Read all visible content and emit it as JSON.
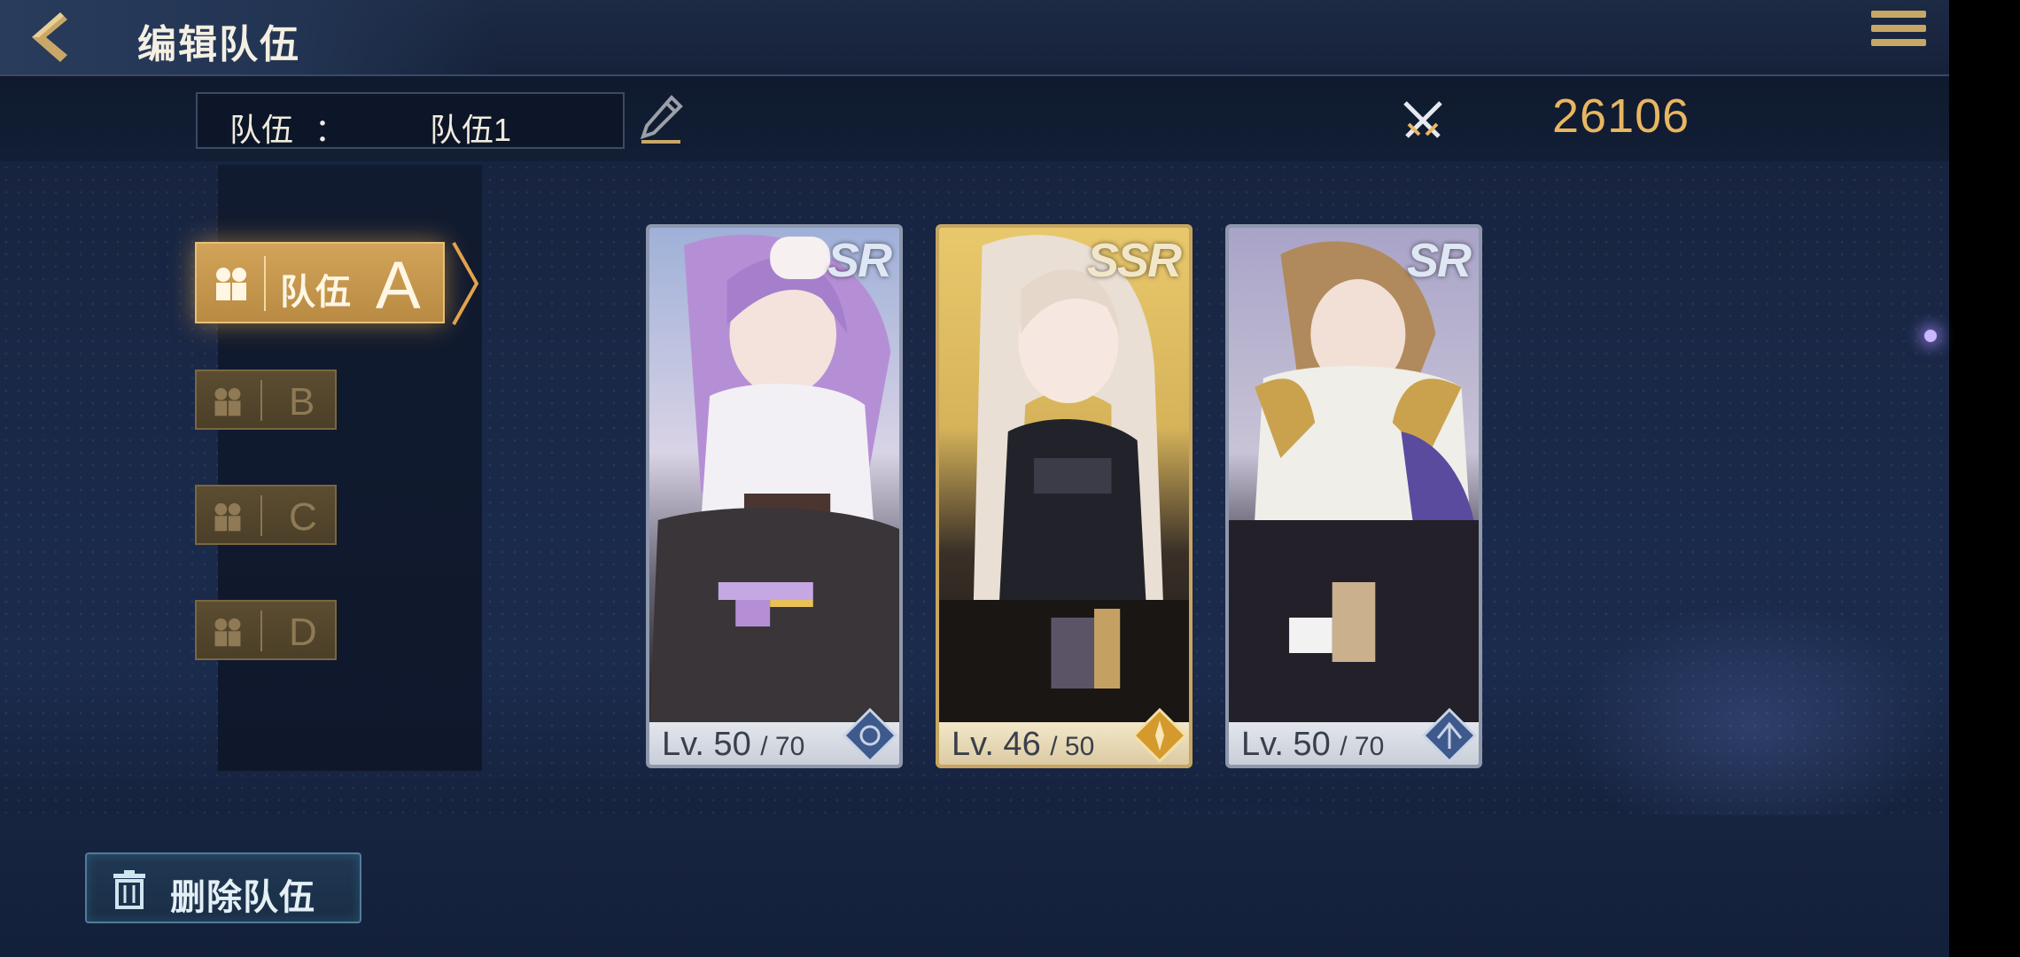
{
  "header": {
    "title": "编辑队伍",
    "back_icon": "chevron-left-icon",
    "menu_icon": "hamburger-menu-icon"
  },
  "team_bar": {
    "label": "队伍",
    "colon": "：",
    "team_name": "队伍1",
    "power_value": "26106"
  },
  "team_tabs": [
    {
      "label": "队伍",
      "letter": "A",
      "selected": true
    },
    {
      "letter": "B",
      "selected": false
    },
    {
      "letter": "C",
      "selected": false
    },
    {
      "letter": "D",
      "selected": false
    }
  ],
  "cards": [
    {
      "rarity": "SR",
      "level": "Lv. 50",
      "max_level": "/ 70"
    },
    {
      "rarity": "SSR",
      "level": "Lv. 46",
      "max_level": "/ 50"
    },
    {
      "rarity": "SR",
      "level": "Lv. 50",
      "max_level": "/ 70"
    }
  ],
  "footer": {
    "delete_label": "删除队伍"
  },
  "colors": {
    "accent_gold": "#e9b660",
    "selected_tab": "#d2a459",
    "delete_border": "#4f7d9a"
  }
}
